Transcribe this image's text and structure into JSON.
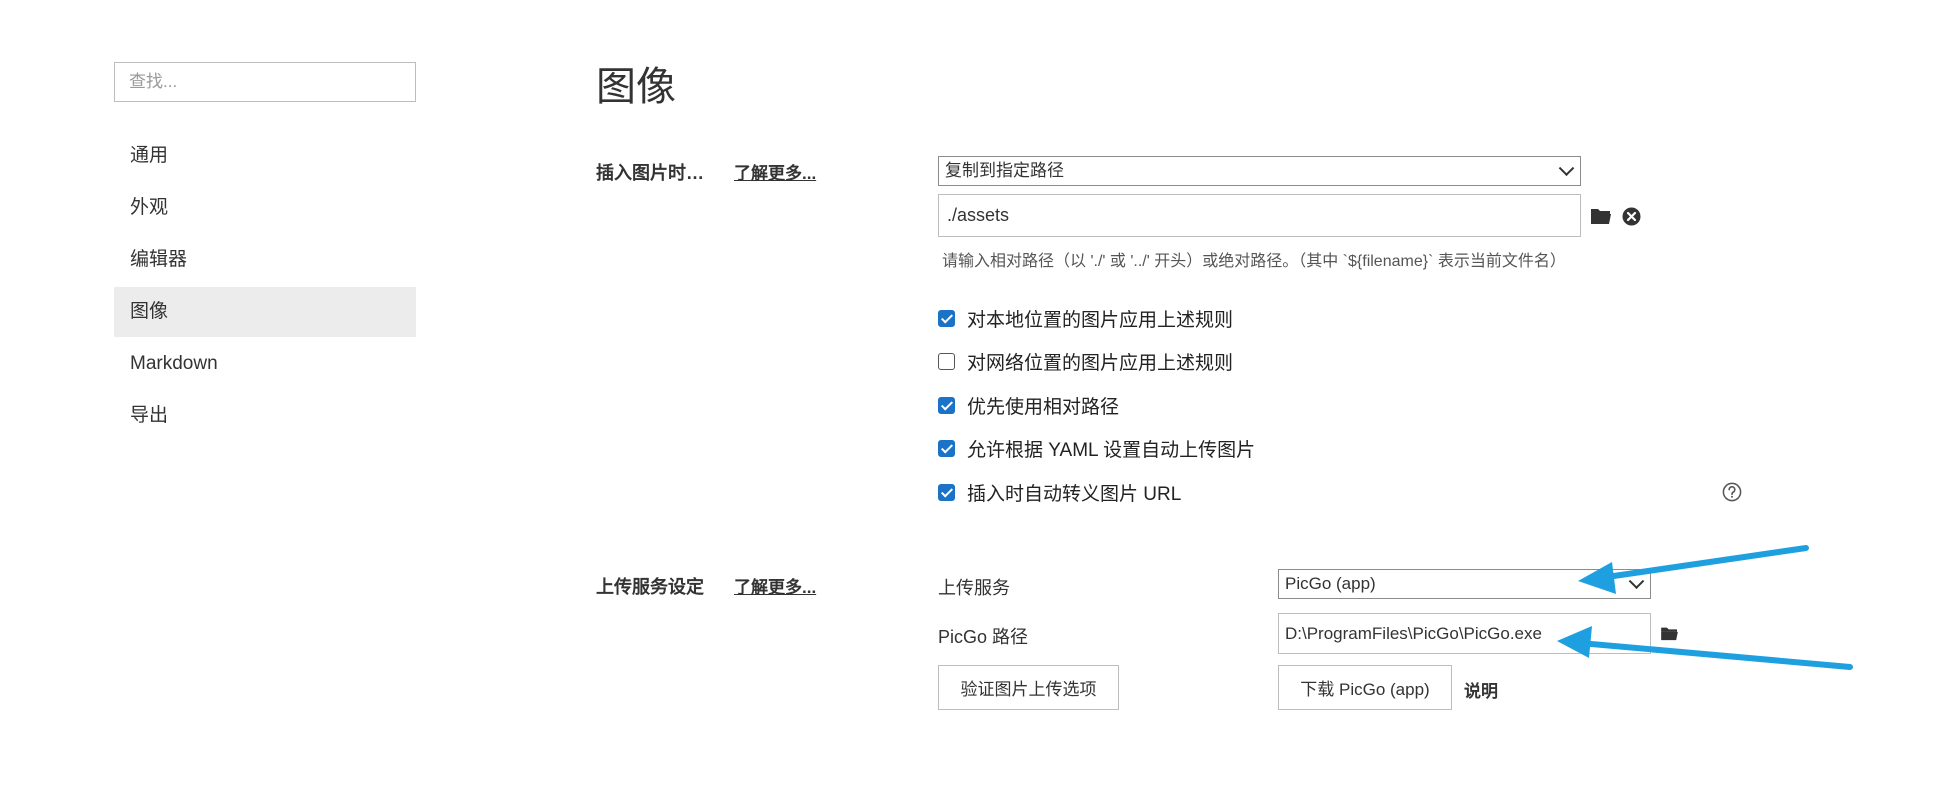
{
  "sidebar": {
    "search_placeholder": "查找...",
    "items": [
      {
        "label": "通用"
      },
      {
        "label": "外观"
      },
      {
        "label": "编辑器"
      },
      {
        "label": "图像"
      },
      {
        "label": "Markdown"
      },
      {
        "label": "导出"
      }
    ],
    "active_item": "图像"
  },
  "main": {
    "title": "图像",
    "insert_section": {
      "label": "插入图片时…",
      "learn_more": "了解更多...",
      "action_select": "复制到指定路径",
      "path_value": "./assets",
      "path_hint": "请输入相对路径（以 './' 或 '../' 开头）或绝对路径。（其中 `${filename}` 表示当前文件名）",
      "options": [
        {
          "label": "对本地位置的图片应用上述规则",
          "checked": true
        },
        {
          "label": "对网络位置的图片应用上述规则",
          "checked": false
        },
        {
          "label": "优先使用相对路径",
          "checked": true
        },
        {
          "label": "允许根据 YAML 设置自动上传图片",
          "checked": true
        },
        {
          "label": "插入时自动转义图片 URL",
          "checked": true
        }
      ]
    },
    "upload_section": {
      "label": "上传服务设定",
      "learn_more": "了解更多...",
      "service_label": "上传服务",
      "service_select": "PicGo (app)",
      "picgo_path_label": "PicGo 路径",
      "picgo_path_value": "D:\\ProgramFiles\\PicGo\\PicGo.exe",
      "verify_button": "验证图片上传选项",
      "download_button": "下载 PicGo (app)",
      "explain_link": "说明"
    }
  },
  "colors": {
    "checkbox": "#1a73c7",
    "annotation_arrow": "#1ea0e0",
    "active_nav_bg": "#ececec"
  }
}
